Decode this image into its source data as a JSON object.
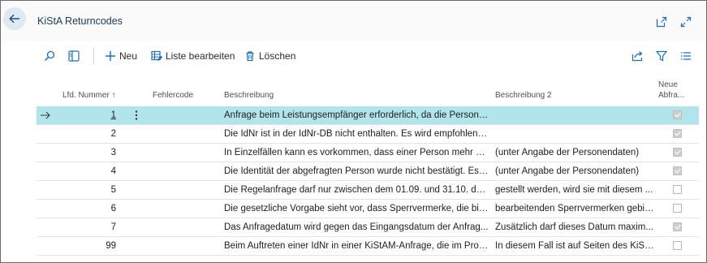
{
  "header": {
    "title": "KiStA Returncodes",
    "icons": [
      "back-arrow-icon",
      "open-in-new-window-icon",
      "expand-icon"
    ]
  },
  "toolbar": {
    "new_label": "Neu",
    "edit_list_label": "Liste bearbeiten",
    "delete_label": "Löschen",
    "icons": [
      "search-icon",
      "filter-pane-icon",
      "plus-icon",
      "edit-list-icon",
      "trash-icon",
      "share-icon",
      "filter-icon",
      "list-view-icon"
    ]
  },
  "columns": {
    "lfd_nummer": "Lfd. Nummer ↑",
    "fehlercode": "Fehlercode",
    "beschreibung": "Beschreibung",
    "beschreibung2": "Beschreibung 2",
    "neue_line1": "Neue",
    "neue_line2": "Abfra..."
  },
  "rows": [
    {
      "nummer": "1",
      "fehlercode": "",
      "beschreibung": "Anfrage beim Leistungsempfänger erforderlich, da die Person i...",
      "beschreibung2": "",
      "neue_abfrage": true
    },
    {
      "nummer": "2",
      "fehlercode": "",
      "beschreibung": "Die IdNr ist in der IdNr-DB nicht enthalten. Es wird empfohlen, ...",
      "beschreibung2": "",
      "neue_abfrage": true
    },
    {
      "nummer": "3",
      "fehlercode": "",
      "beschreibung": "In Einzelfällen kann es vorkommen, dass einer Person mehr als ...",
      "beschreibung2": "(unter Angabe der Personendaten)",
      "neue_abfrage": true
    },
    {
      "nummer": "4",
      "fehlercode": "",
      "beschreibung": "Die Identität der abgefragten Person wurde nicht bestätigt. Es ...",
      "beschreibung2": "(unter Angabe der Personendaten)",
      "neue_abfrage": true
    },
    {
      "nummer": "5",
      "fehlercode": "",
      "beschreibung": "Die Regelanfrage darf nur zwischen dem 01.09. und 31.10. des I...",
      "beschreibung2": "gestellt werden, wird sie mit diesem ...",
      "neue_abfrage": false
    },
    {
      "nummer": "6",
      "fehlercode": "",
      "beschreibung": "Die gesetzliche Vorgabe sieht vor, dass Sperrvermerke, die bis ...",
      "beschreibung2": "bearbeitenden Sperrvermerken gebil...",
      "neue_abfrage": false
    },
    {
      "nummer": "7",
      "fehlercode": "",
      "beschreibung": "Das Anfragedatum wird gegen das Eingangsdatum der Anfrag...",
      "beschreibung2": "Zusätzlich darf dieses Datum maxim...",
      "neue_abfrage": true
    },
    {
      "nummer": "99",
      "fehlercode": "",
      "beschreibung": "Beim Auftreten einer IdNr in einer KiStAM-Anfrage, die im Prod...",
      "beschreibung2": "In diesem Fall ist auf Seiten des KiStA...",
      "neue_abfrage": false
    }
  ],
  "selected_row": 0,
  "colors": {
    "accent": "#1a6fb5",
    "selected_row": "#b2e4eb",
    "back_button": "#dde9f3"
  }
}
